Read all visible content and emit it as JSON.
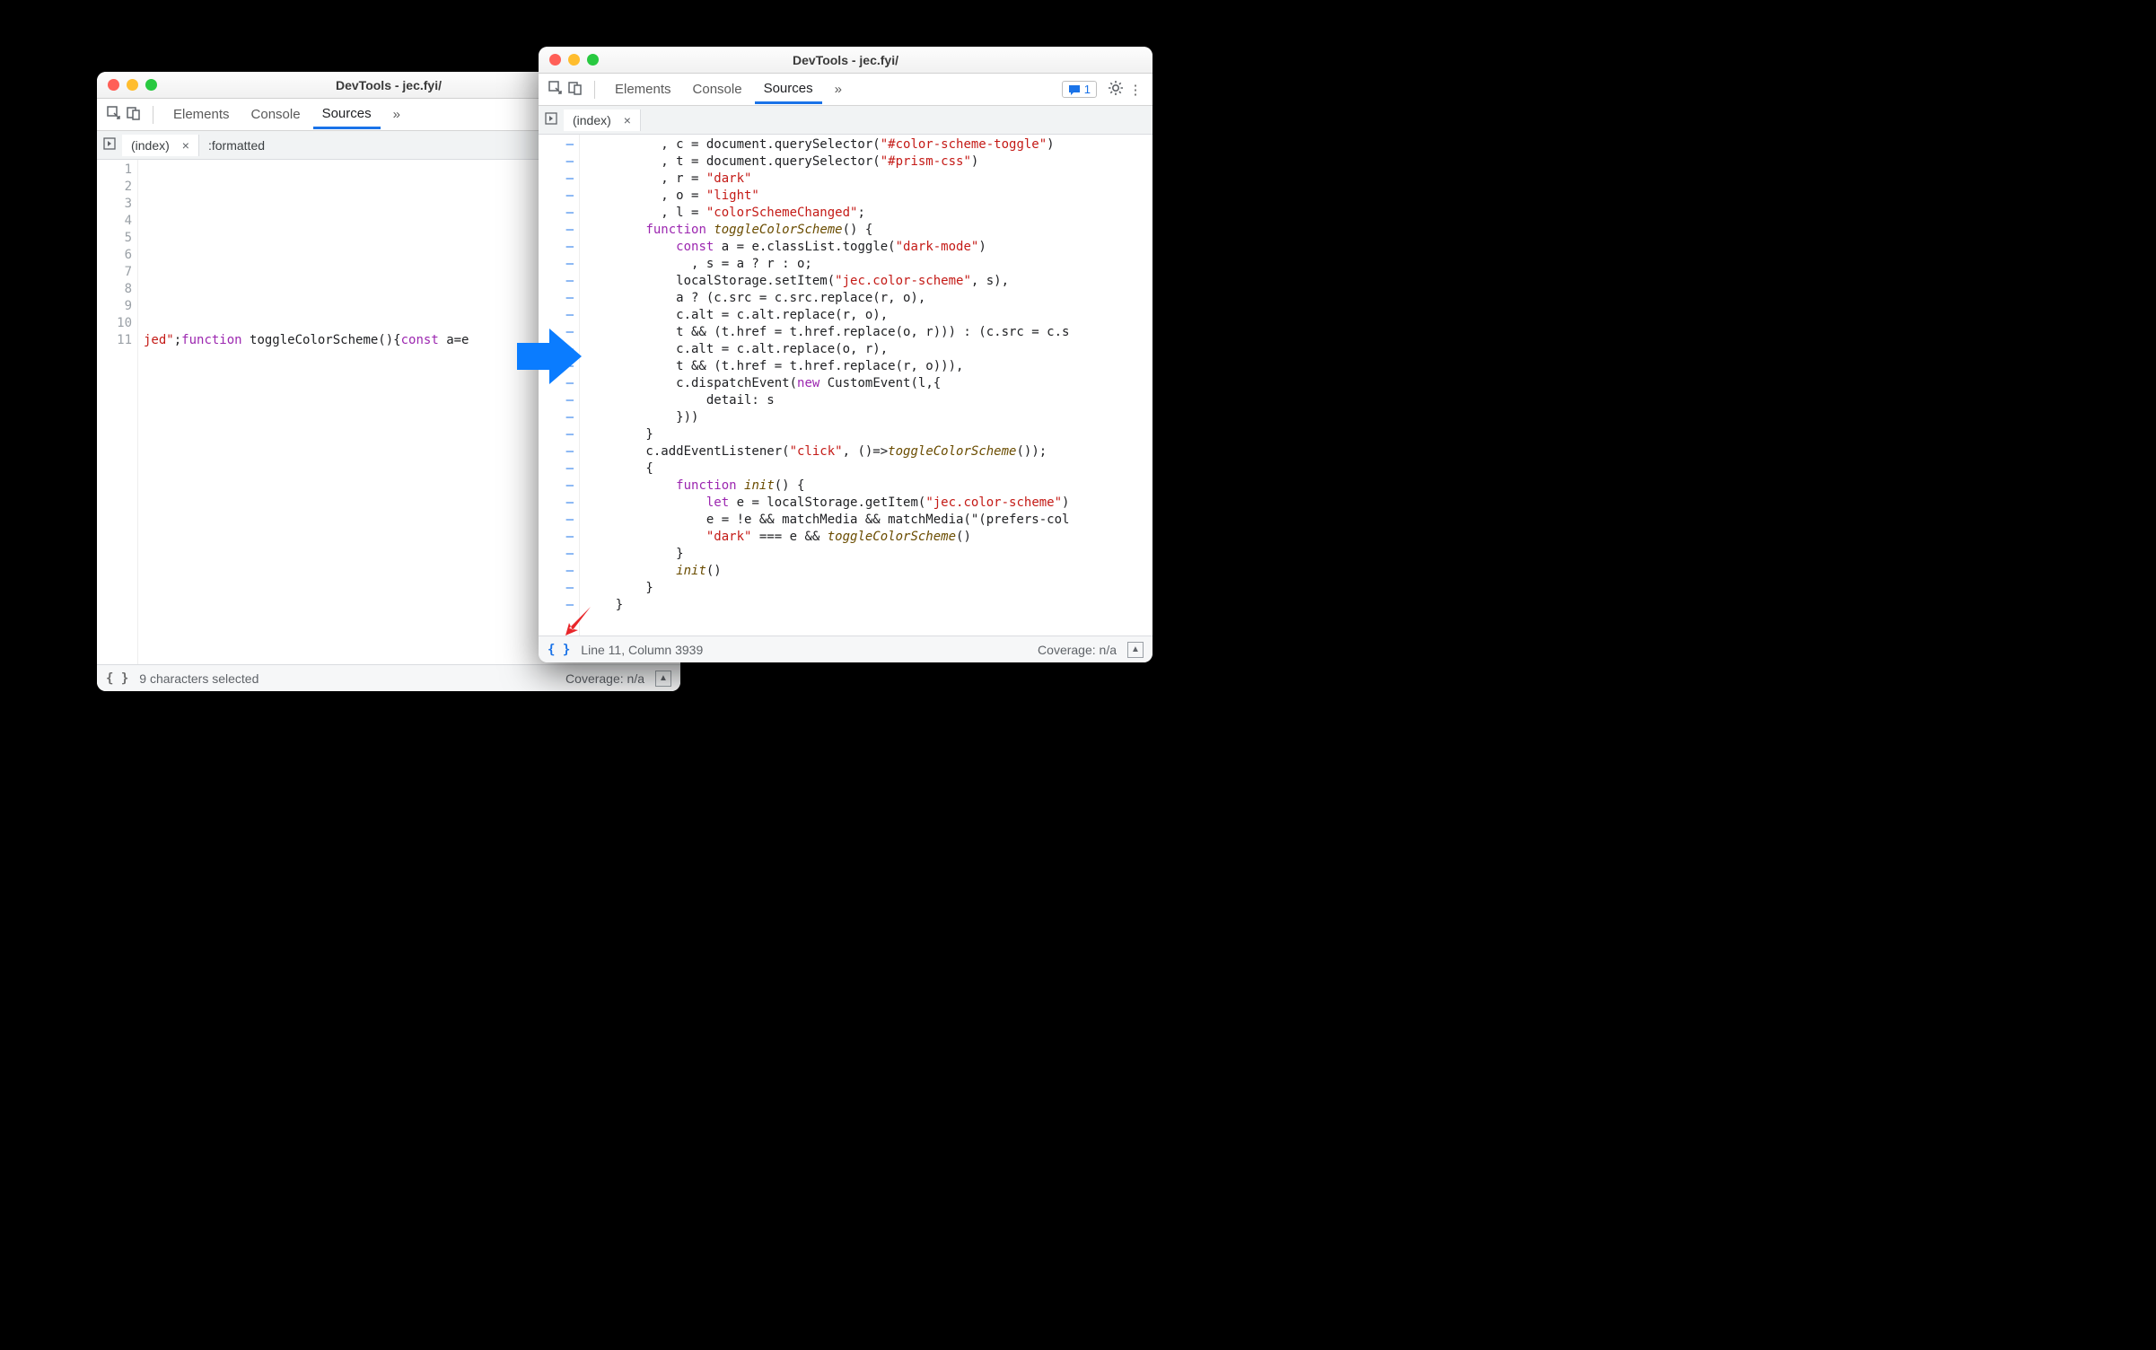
{
  "windows": {
    "left": {
      "title": "DevTools - jec.fyi/",
      "tabs": {
        "elements": "Elements",
        "console": "Console",
        "sources": "Sources"
      },
      "filetabs": {
        "index": "(index)",
        "formatted": ":formatted"
      },
      "gutter": [
        "1",
        "2",
        "3",
        "4",
        "5",
        "6",
        "7",
        "8",
        "9",
        "10",
        "11"
      ],
      "code_frag": {
        "p1": "jed\"",
        "p2": ";",
        "kw1": "function",
        "sp1": " toggleColorScheme(){",
        "kw2": "const",
        "sp2": " a=e"
      },
      "status": {
        "selection": "9 characters selected",
        "coverage": "Coverage: n/a"
      }
    },
    "right": {
      "title": "DevTools - jec.fyi/",
      "tabs": {
        "elements": "Elements",
        "console": "Console",
        "sources": "Sources"
      },
      "msg_count": "1",
      "filetabs": {
        "index": "(index)"
      },
      "status": {
        "pos": "Line 11, Column 3939",
        "coverage": "Coverage: n/a"
      },
      "code": {
        "l1": "          , c = document.querySelector(\"#color-scheme-toggle\")",
        "l2": "          , t = document.querySelector(\"#prism-css\")",
        "l3": "          , r = \"dark\"",
        "l4": "          , o = \"light\"",
        "l5": "          , l = \"colorSchemeChanged\";",
        "l6": "        function toggleColorScheme() {",
        "l7": "            const a = e.classList.toggle(\"dark-mode\")",
        "l8": "              , s = a ? r : o;",
        "l9": "            localStorage.setItem(\"jec.color-scheme\", s),",
        "l10": "            a ? (c.src = c.src.replace(r, o),",
        "l11": "            c.alt = c.alt.replace(r, o),",
        "l12": "            t && (t.href = t.href.replace(o, r))) : (c.src = c.s",
        "l13": "            c.alt = c.alt.replace(o, r),",
        "l14": "            t && (t.href = t.href.replace(r, o))),",
        "l15": "            c.dispatchEvent(new CustomEvent(l,{",
        "l16": "                detail: s",
        "l17": "            }))",
        "l18": "        }",
        "l19": "        c.addEventListener(\"click\", ()=>toggleColorScheme());",
        "l20": "        {",
        "l21": "            function init() {",
        "l22": "                let e = localStorage.getItem(\"jec.color-scheme\")",
        "l23": "                e = !e && matchMedia && matchMedia(\"(prefers-col",
        "l24": "                \"dark\" === e && toggleColorScheme()",
        "l25": "            }",
        "l26": "            init()",
        "l27": "        }",
        "l28": "    }"
      }
    }
  }
}
